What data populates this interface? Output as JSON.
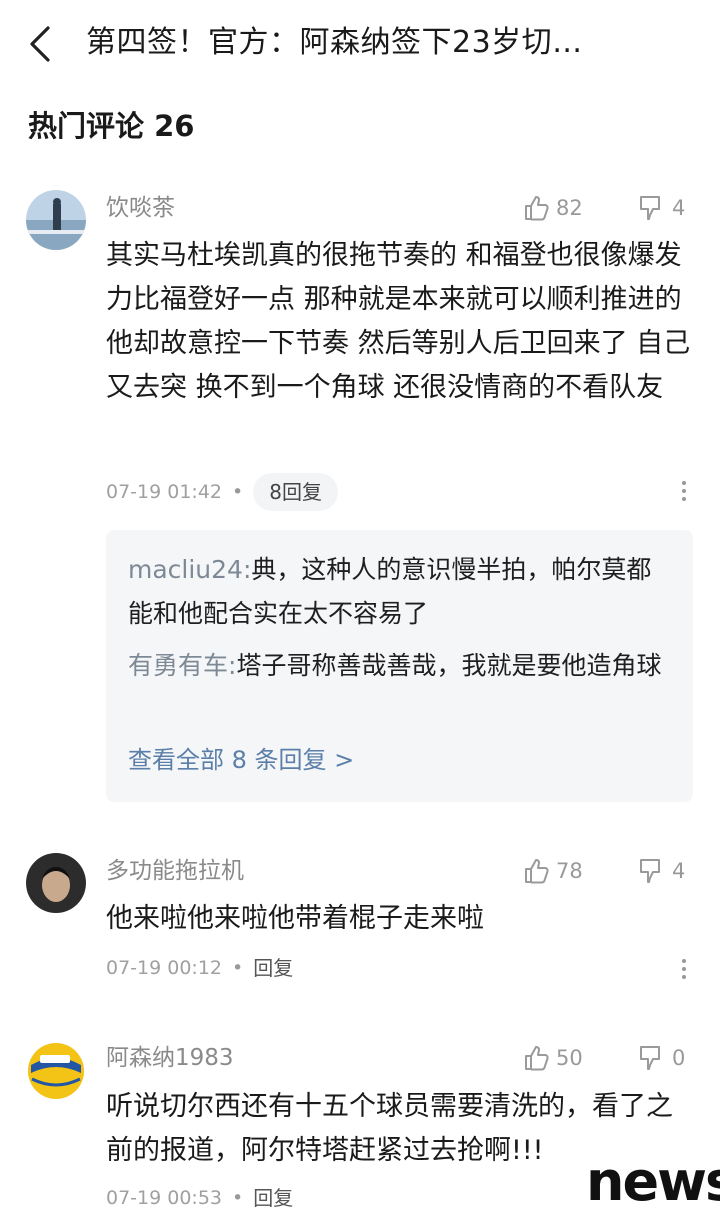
{
  "header": {
    "title": "第四签！官方：阿森纳签下23岁切…",
    "back_icon": "chevron-left-icon"
  },
  "section": {
    "title": "热门评论 26"
  },
  "comments": [
    {
      "username": "饮啖茶",
      "likes": "82",
      "dislikes": "4",
      "text": "其实马杜埃凯真的很拖节奏的 和福登也很像爆发力比福登好一点 那种就是本来就可以顺利推进的 他却故意控一下节奏 然后等别人后卫回来了 自己又去突 换不到一个角球 还很没情商的不看队友",
      "time": "07-19 01:42",
      "reply_label": "8回复",
      "replies": [
        {
          "name": "macliu24:",
          "text": "典，这种人的意识慢半拍，帕尔莫都能和他配合实在太不容易了"
        },
        {
          "name": "有勇有车:",
          "text": "塔子哥称善哉善哉，我就是要他造角球"
        }
      ],
      "view_all": "查看全部 8 条回复 >"
    },
    {
      "username": "多功能拖拉机",
      "likes": "78",
      "dislikes": "4",
      "text": "他来啦他来啦他带着棍子走来啦",
      "time": "07-19 00:12",
      "reply_label": "回复"
    },
    {
      "username": "阿森纳1983",
      "likes": "50",
      "dislikes": "0",
      "text": "听说切尔西还有十五个球员需要清洗的，看了之前的报道，阿尔特塔赶紧过去抢啊!!!",
      "time": "07-19 00:53",
      "reply_label": "回复"
    }
  ],
  "meta_separator": "•",
  "watermark": "news",
  "colors": {
    "meta_gray": "#a0a0a0",
    "name_link": "#5b7fa8",
    "reply_bg": "#f5f6f8"
  }
}
